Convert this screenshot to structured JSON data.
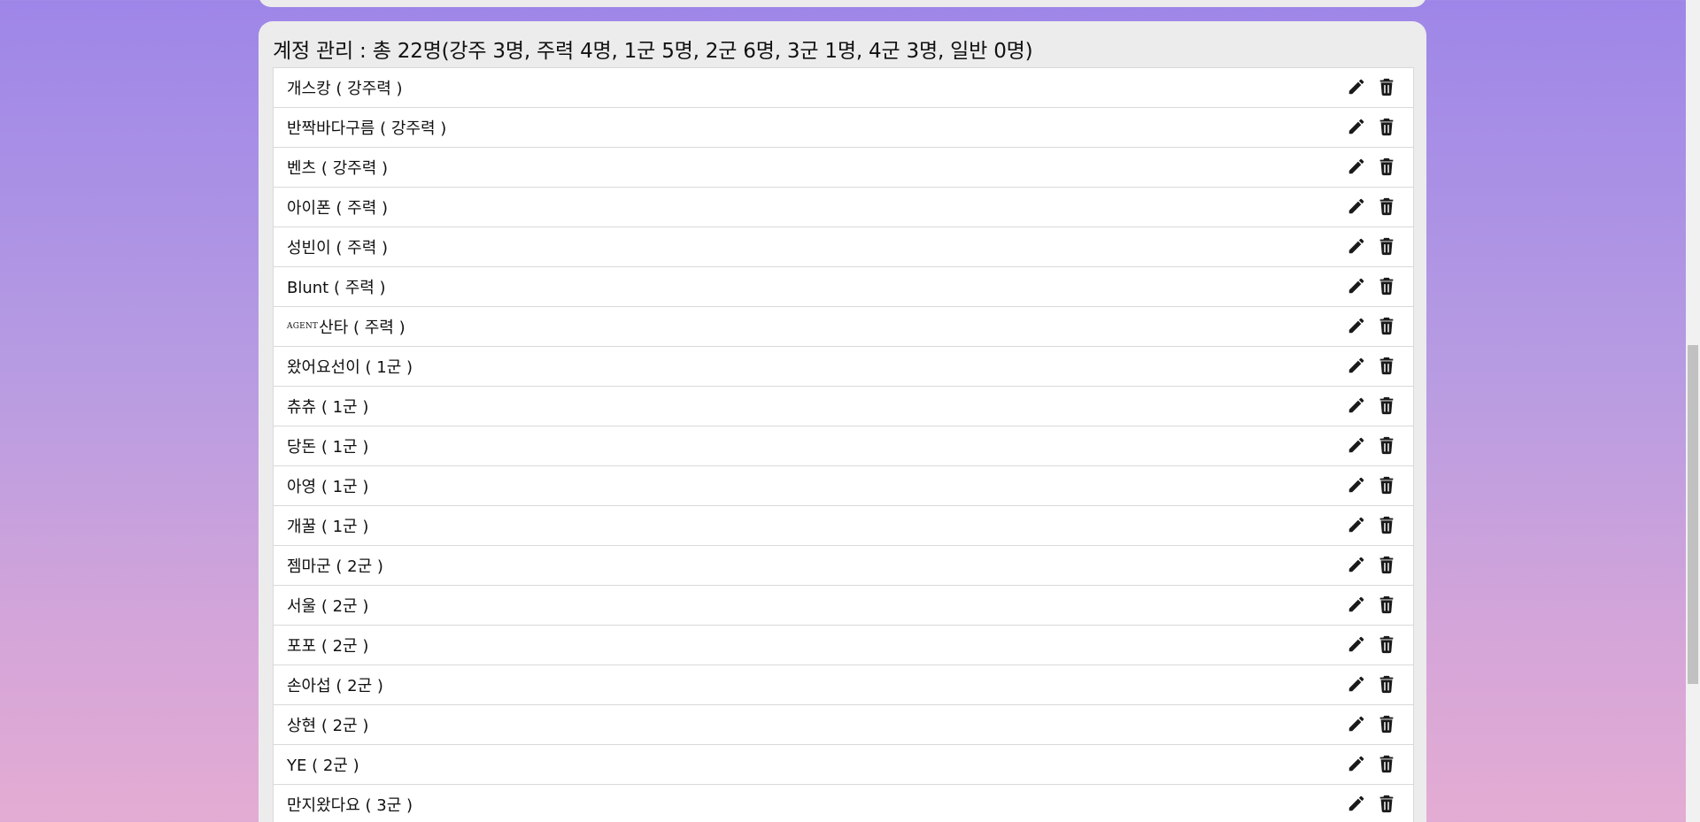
{
  "header": {
    "title": "계정 관리 : 총 22명(강주 3명, 주력 4명, 1군 5명, 2군 6명, 3군 1명, 4군 3명, 일반 0명)"
  },
  "accounts": [
    {
      "prefix": "",
      "label": "개스캉 ( 강주력 )"
    },
    {
      "prefix": "",
      "label": "반짝바다구름 ( 강주력 )"
    },
    {
      "prefix": "",
      "label": "벤츠 ( 강주력 )"
    },
    {
      "prefix": "",
      "label": "아이폰 ( 주력 )"
    },
    {
      "prefix": "",
      "label": "성빈이 ( 주력 )"
    },
    {
      "prefix": "",
      "label": "Blunt ( 주력 )"
    },
    {
      "prefix": "AGENT",
      "label": "산타 ( 주력 )"
    },
    {
      "prefix": "",
      "label": "왔어요선이 ( 1군 )"
    },
    {
      "prefix": "",
      "label": "츄츄 ( 1군 )"
    },
    {
      "prefix": "",
      "label": "당돈 ( 1군 )"
    },
    {
      "prefix": "",
      "label": "아영 ( 1군 )"
    },
    {
      "prefix": "",
      "label": "개꿀 ( 1군 )"
    },
    {
      "prefix": "",
      "label": "젬마군 ( 2군 )"
    },
    {
      "prefix": "",
      "label": "서울 ( 2군 )"
    },
    {
      "prefix": "",
      "label": "포포 ( 2군 )"
    },
    {
      "prefix": "",
      "label": "손아섭 ( 2군 )"
    },
    {
      "prefix": "",
      "label": "상현 ( 2군 )"
    },
    {
      "prefix": "",
      "label": "YE ( 2군 )"
    },
    {
      "prefix": "",
      "label": "만지왔다요 ( 3군 )"
    }
  ],
  "icons": {
    "edit": "pencil-icon",
    "delete": "trash-icon"
  },
  "colors": {
    "background_top": "#9e86e8",
    "background_bottom": "#e3acd3",
    "card": "#ececec",
    "icon": "#1a1a1a"
  }
}
